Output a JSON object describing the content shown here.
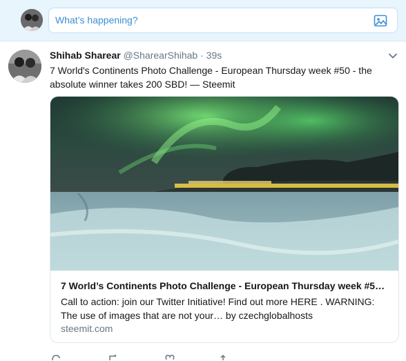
{
  "compose": {
    "placeholder": "What’s happening?",
    "avatar_icon": "user-avatar-icon",
    "media_icon": "image-icon"
  },
  "tweet": {
    "author_name": "Shihab Sharear",
    "handle": "@SharearShihab",
    "separator": "·",
    "time": "39s",
    "text": "7 World's Continents Photo Challenge - European Thursday week #50 - the absolute winner takes 200 SBD! — Steemit",
    "card": {
      "title": "7 World’s Continents Photo Challenge - European Thursday week #5…",
      "description": "Call to action: join our Twitter Initiative! Find out more HERE . WARNING: The use of images that are not your… by czechglobalhosts",
      "domain": "steemit.com"
    }
  },
  "colors": {
    "compose_bg": "#e8f5fd",
    "accent": "#3a8fd6",
    "text": "#14171a",
    "muted": "#657786"
  }
}
